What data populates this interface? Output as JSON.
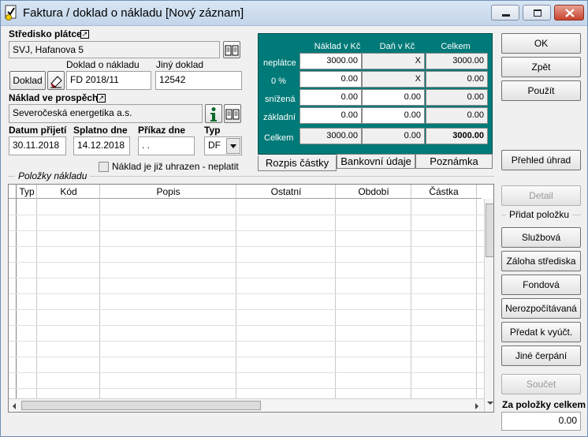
{
  "window": {
    "title": "Faktura / doklad o nákladu  [Nový záznam]"
  },
  "stredisko": {
    "label": "Středisko plátce",
    "value": "SVJ, Hafanova 5"
  },
  "doklad": {
    "label_doklad": "Doklad o nákladu",
    "label_jiny": "Jiný doklad",
    "button": "Doklad",
    "value_doklad": "FD 2018/11",
    "value_jiny": "12542"
  },
  "naklad": {
    "label": "Náklad ve prospěch",
    "value": "Severočeská energetika a.s."
  },
  "dates": {
    "label_prijeti": "Datum přijetí",
    "label_splatno": "Splatno dne",
    "label_prikaz": "Příkaz dne",
    "label_typ": "Typ",
    "value_prijeti": "30.11.2018",
    "value_splatno": "14.12.2018",
    "value_prikaz": " .  .",
    "value_typ": "DF"
  },
  "checkbox": {
    "label": "Náklad je již uhrazen - neplatit",
    "checked": false
  },
  "summary": {
    "headers": [
      "Náklad v Kč",
      "Daň v Kč",
      "Celkem"
    ],
    "rows": [
      {
        "label": "neplátce",
        "naklad": "3000.00",
        "dan": "X",
        "celkem": "3000.00"
      },
      {
        "label": "0 %",
        "naklad": "0.00",
        "dan": "X",
        "celkem": "0.00"
      },
      {
        "label": "snížená",
        "naklad": "0.00",
        "dan": "0.00",
        "celkem": "0.00"
      },
      {
        "label": "základní",
        "naklad": "0.00",
        "dan": "0.00",
        "celkem": "0.00"
      }
    ],
    "total": {
      "label": "Celkem",
      "naklad": "3000.00",
      "dan": "0.00",
      "celkem": "3000.00"
    }
  },
  "tabs": [
    "Rozpis částky",
    "Bankovní údaje",
    "Poznámka"
  ],
  "items": {
    "group_label": "Položky nákladu",
    "columns": [
      "Typ",
      "Kód",
      "Popis",
      "Ostatní",
      "Období",
      "Částka"
    ]
  },
  "buttons": {
    "ok": "OK",
    "zpet": "Zpět",
    "pouzit": "Použít",
    "prehled": "Přehled úhrad",
    "detail": "Detail",
    "pridat_label": "Přidat položku",
    "sluzbova": "Službová",
    "zaloha": "Záloha střediska",
    "fondova": "Fondová",
    "nerozpoctovana": "Nerozpočítávaná",
    "predat": "Předat k vyúčt.",
    "jine": "Jiné čerpání",
    "soucet": "Součet",
    "za_polozky_label": "Za položky celkem",
    "za_polozky_value": "0.00"
  },
  "colors": {
    "teal": "#007a78",
    "titlebar": "#c3d5ea"
  }
}
